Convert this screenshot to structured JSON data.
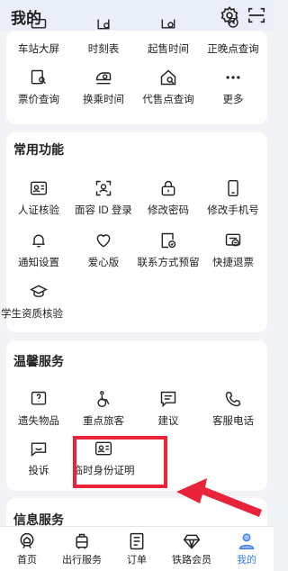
{
  "header": {
    "title": "我的",
    "icons": [
      "gear-icon",
      "scan-icon"
    ]
  },
  "top_grid": {
    "row1": [
      {
        "label": "车站大屏",
        "icon": "station-screen-icon"
      },
      {
        "label": "时刻表",
        "icon": "timetable-icon"
      },
      {
        "label": "起售时间",
        "icon": "sale-time-icon"
      },
      {
        "label": "正晚点查询",
        "icon": "delay-query-icon"
      }
    ],
    "row2": [
      {
        "label": "票价查询",
        "icon": "fare-query-icon"
      },
      {
        "label": "换乘时间",
        "icon": "transfer-time-icon"
      },
      {
        "label": "代售点查询",
        "icon": "agency-query-icon"
      },
      {
        "label": "更多",
        "icon": "more-icon"
      }
    ]
  },
  "common": {
    "title": "常用功能",
    "items": [
      {
        "label": "人证核验",
        "icon": "id-card-icon"
      },
      {
        "label": "面容 ID 登录",
        "icon": "face-id-icon"
      },
      {
        "label": "修改密码",
        "icon": "lock-icon"
      },
      {
        "label": "修改手机号",
        "icon": "phone-icon"
      },
      {
        "label": "通知设置",
        "icon": "bell-icon"
      },
      {
        "label": "爱心版",
        "icon": "heart-icon"
      },
      {
        "label": "联系方式预留",
        "icon": "contact-icon"
      },
      {
        "label": "快捷退票",
        "icon": "refund-icon"
      },
      {
        "label": "学生资质核验",
        "icon": "graduation-cap-icon"
      }
    ]
  },
  "warm": {
    "title": "温馨服务",
    "items": [
      {
        "label": "遗失物品",
        "icon": "lost-item-icon"
      },
      {
        "label": "重点旅客",
        "icon": "wheelchair-icon"
      },
      {
        "label": "建议",
        "icon": "suggestion-icon"
      },
      {
        "label": "客服电话",
        "icon": "phone-call-icon"
      },
      {
        "label": "投诉",
        "icon": "complaint-icon"
      },
      {
        "label": "临时身份证明",
        "icon": "temp-id-icon"
      }
    ]
  },
  "info": {
    "title": "信息服务"
  },
  "tabbar": [
    {
      "label": "首页",
      "icon": "home-icon"
    },
    {
      "label": "出行服务",
      "icon": "travel-icon"
    },
    {
      "label": "订单",
      "icon": "order-icon"
    },
    {
      "label": "铁路会员",
      "icon": "member-icon"
    },
    {
      "label": "我的",
      "icon": "profile-icon"
    }
  ],
  "colors": {
    "accent": "#3b7cf6",
    "highlight": "#e8233a",
    "background": "#f1f3f7"
  }
}
